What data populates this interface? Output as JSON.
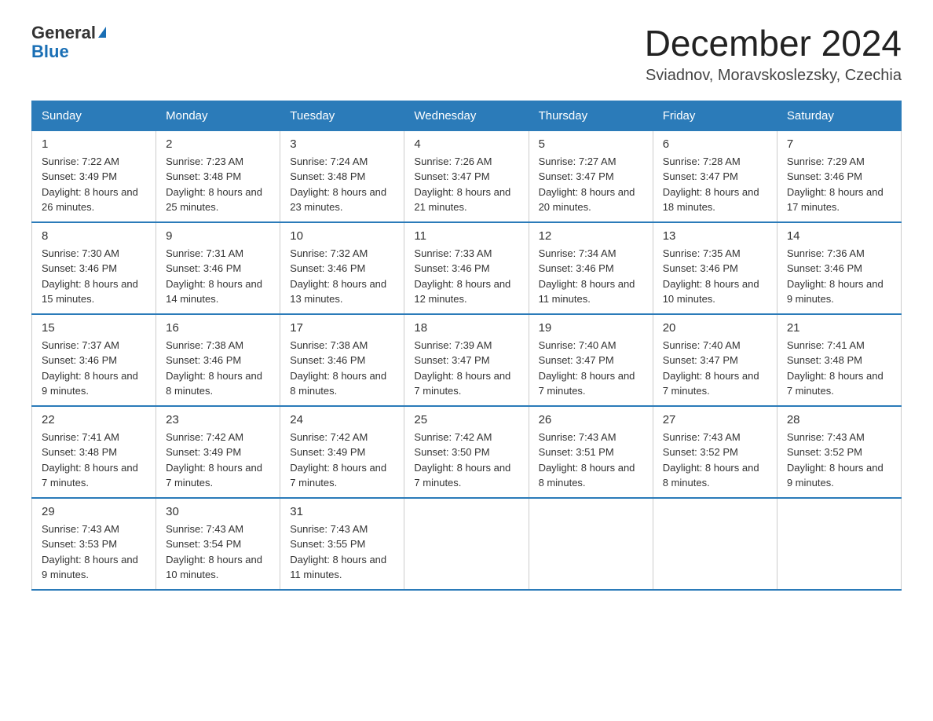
{
  "header": {
    "logo_general": "General",
    "logo_blue": "Blue",
    "month_year": "December 2024",
    "location": "Sviadnov, Moravskoslezsky, Czechia"
  },
  "weekdays": [
    "Sunday",
    "Monday",
    "Tuesday",
    "Wednesday",
    "Thursday",
    "Friday",
    "Saturday"
  ],
  "weeks": [
    [
      {
        "day": "1",
        "sunrise": "7:22 AM",
        "sunset": "3:49 PM",
        "daylight": "8 hours and 26 minutes."
      },
      {
        "day": "2",
        "sunrise": "7:23 AM",
        "sunset": "3:48 PM",
        "daylight": "8 hours and 25 minutes."
      },
      {
        "day": "3",
        "sunrise": "7:24 AM",
        "sunset": "3:48 PM",
        "daylight": "8 hours and 23 minutes."
      },
      {
        "day": "4",
        "sunrise": "7:26 AM",
        "sunset": "3:47 PM",
        "daylight": "8 hours and 21 minutes."
      },
      {
        "day": "5",
        "sunrise": "7:27 AM",
        "sunset": "3:47 PM",
        "daylight": "8 hours and 20 minutes."
      },
      {
        "day": "6",
        "sunrise": "7:28 AM",
        "sunset": "3:47 PM",
        "daylight": "8 hours and 18 minutes."
      },
      {
        "day": "7",
        "sunrise": "7:29 AM",
        "sunset": "3:46 PM",
        "daylight": "8 hours and 17 minutes."
      }
    ],
    [
      {
        "day": "8",
        "sunrise": "7:30 AM",
        "sunset": "3:46 PM",
        "daylight": "8 hours and 15 minutes."
      },
      {
        "day": "9",
        "sunrise": "7:31 AM",
        "sunset": "3:46 PM",
        "daylight": "8 hours and 14 minutes."
      },
      {
        "day": "10",
        "sunrise": "7:32 AM",
        "sunset": "3:46 PM",
        "daylight": "8 hours and 13 minutes."
      },
      {
        "day": "11",
        "sunrise": "7:33 AM",
        "sunset": "3:46 PM",
        "daylight": "8 hours and 12 minutes."
      },
      {
        "day": "12",
        "sunrise": "7:34 AM",
        "sunset": "3:46 PM",
        "daylight": "8 hours and 11 minutes."
      },
      {
        "day": "13",
        "sunrise": "7:35 AM",
        "sunset": "3:46 PM",
        "daylight": "8 hours and 10 minutes."
      },
      {
        "day": "14",
        "sunrise": "7:36 AM",
        "sunset": "3:46 PM",
        "daylight": "8 hours and 9 minutes."
      }
    ],
    [
      {
        "day": "15",
        "sunrise": "7:37 AM",
        "sunset": "3:46 PM",
        "daylight": "8 hours and 9 minutes."
      },
      {
        "day": "16",
        "sunrise": "7:38 AM",
        "sunset": "3:46 PM",
        "daylight": "8 hours and 8 minutes."
      },
      {
        "day": "17",
        "sunrise": "7:38 AM",
        "sunset": "3:46 PM",
        "daylight": "8 hours and 8 minutes."
      },
      {
        "day": "18",
        "sunrise": "7:39 AM",
        "sunset": "3:47 PM",
        "daylight": "8 hours and 7 minutes."
      },
      {
        "day": "19",
        "sunrise": "7:40 AM",
        "sunset": "3:47 PM",
        "daylight": "8 hours and 7 minutes."
      },
      {
        "day": "20",
        "sunrise": "7:40 AM",
        "sunset": "3:47 PM",
        "daylight": "8 hours and 7 minutes."
      },
      {
        "day": "21",
        "sunrise": "7:41 AM",
        "sunset": "3:48 PM",
        "daylight": "8 hours and 7 minutes."
      }
    ],
    [
      {
        "day": "22",
        "sunrise": "7:41 AM",
        "sunset": "3:48 PM",
        "daylight": "8 hours and 7 minutes."
      },
      {
        "day": "23",
        "sunrise": "7:42 AM",
        "sunset": "3:49 PM",
        "daylight": "8 hours and 7 minutes."
      },
      {
        "day": "24",
        "sunrise": "7:42 AM",
        "sunset": "3:49 PM",
        "daylight": "8 hours and 7 minutes."
      },
      {
        "day": "25",
        "sunrise": "7:42 AM",
        "sunset": "3:50 PM",
        "daylight": "8 hours and 7 minutes."
      },
      {
        "day": "26",
        "sunrise": "7:43 AM",
        "sunset": "3:51 PM",
        "daylight": "8 hours and 8 minutes."
      },
      {
        "day": "27",
        "sunrise": "7:43 AM",
        "sunset": "3:52 PM",
        "daylight": "8 hours and 8 minutes."
      },
      {
        "day": "28",
        "sunrise": "7:43 AM",
        "sunset": "3:52 PM",
        "daylight": "8 hours and 9 minutes."
      }
    ],
    [
      {
        "day": "29",
        "sunrise": "7:43 AM",
        "sunset": "3:53 PM",
        "daylight": "8 hours and 9 minutes."
      },
      {
        "day": "30",
        "sunrise": "7:43 AM",
        "sunset": "3:54 PM",
        "daylight": "8 hours and 10 minutes."
      },
      {
        "day": "31",
        "sunrise": "7:43 AM",
        "sunset": "3:55 PM",
        "daylight": "8 hours and 11 minutes."
      },
      null,
      null,
      null,
      null
    ]
  ],
  "labels": {
    "sunrise": "Sunrise:",
    "sunset": "Sunset:",
    "daylight": "Daylight:"
  }
}
